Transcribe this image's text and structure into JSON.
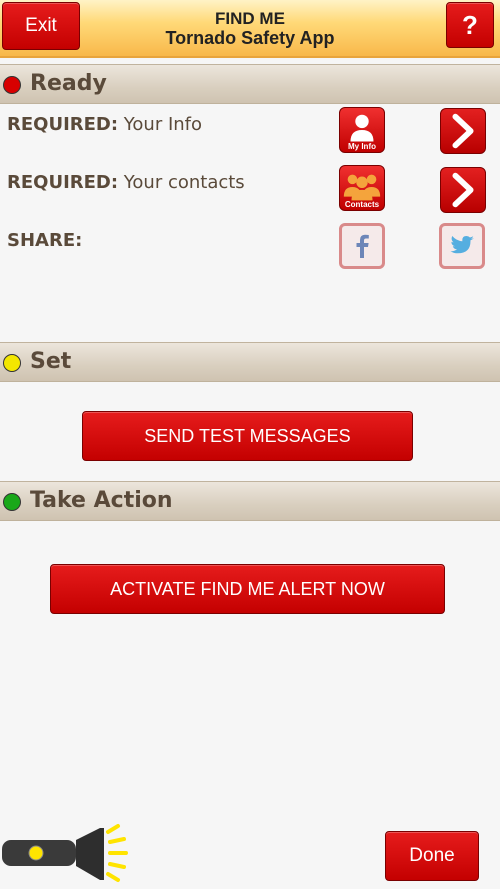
{
  "header": {
    "exit_label": "Exit",
    "title_line1": "FIND ME",
    "title_line2": "Tornado Safety App",
    "help_label": "?"
  },
  "sections": {
    "ready": {
      "label": "Ready",
      "dot_color": "#d80000"
    },
    "set": {
      "label": "Set",
      "dot_color": "#f3e600"
    },
    "take_action": {
      "label": "Take Action",
      "dot_color": "#1aa81a"
    }
  },
  "ready_rows": {
    "info": {
      "prefix": "REQUIRED:",
      "text": " Your Info",
      "icon_caption": "My Info"
    },
    "contacts": {
      "prefix": "REQUIRED:",
      "text": " Your contacts",
      "icon_caption": "Contacts"
    },
    "share": {
      "prefix": "SHARE:"
    }
  },
  "buttons": {
    "send_test": "SEND TEST MESSAGES",
    "activate": "ACTIVATE FIND ME ALERT NOW",
    "done": "Done"
  },
  "icons": {
    "my_info": "user-icon",
    "contacts": "users-icon",
    "facebook": "facebook-icon",
    "twitter": "twitter-icon",
    "arrow": "chevron-right-icon",
    "flashlight": "flashlight-icon"
  },
  "colors": {
    "accent_red": "#cc0000",
    "label_brown": "#5a4a3a",
    "header_orange": "#f8b84a"
  }
}
